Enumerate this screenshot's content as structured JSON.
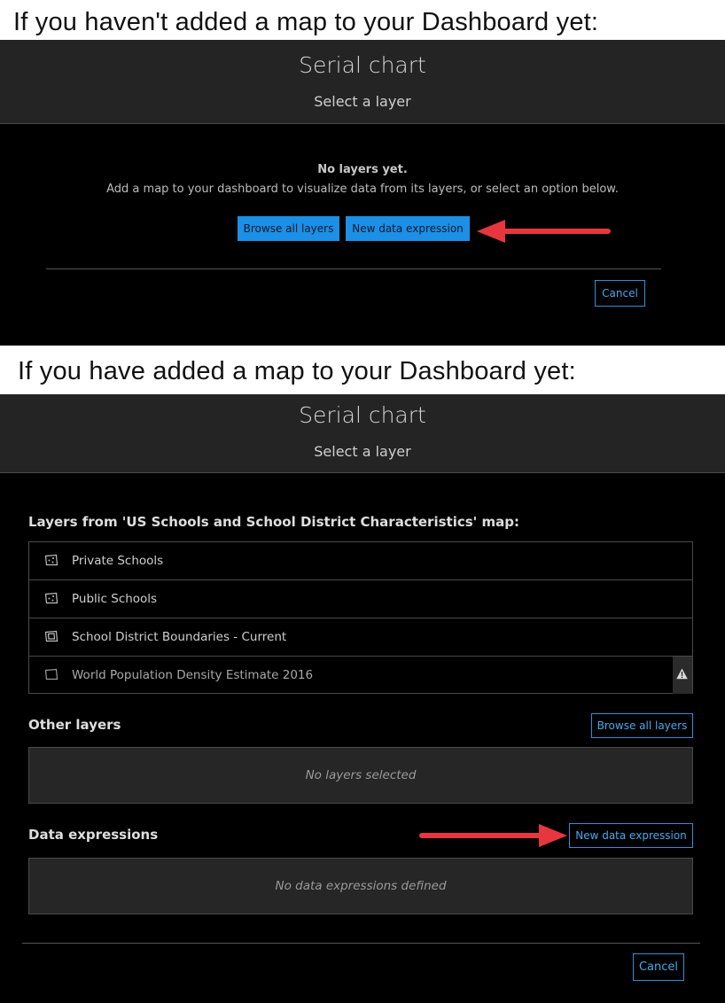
{
  "captions": {
    "top": "If you haven't added a map to your Dashboard yet:",
    "bottom": "If you have added a map to your Dashboard yet:"
  },
  "panel1": {
    "title": "Serial chart",
    "subtitle": "Select a layer",
    "empty_title": "No layers yet.",
    "empty_desc": "Add a map to your dashboard to visualize data from its layers, or select an option below.",
    "browse_label": "Browse all layers",
    "new_expr_label": "New data expression",
    "cancel_label": "Cancel"
  },
  "panel2": {
    "title": "Serial chart",
    "subtitle": "Select a layer",
    "map_layers_heading": "Layers from 'US Schools and School District Characteristics' map:",
    "layers": [
      {
        "label": "Private Schools",
        "icon": "point-layer-icon"
      },
      {
        "label": "Public Schools",
        "icon": "point-layer-icon"
      },
      {
        "label": "School District Boundaries - Current",
        "icon": "polygon-layer-icon"
      },
      {
        "label": "World Population Density Estimate 2016",
        "icon": "tile-layer-icon",
        "warning": true
      }
    ],
    "other_layers_heading": "Other layers",
    "browse_label": "Browse all layers",
    "no_layers_text": "No layers selected",
    "data_expressions_heading": "Data expressions",
    "new_expr_label": "New data expression",
    "no_expr_text": "No data expressions defined",
    "cancel_label": "Cancel"
  },
  "colors": {
    "accent": "#1c8fe6",
    "arrow": "#e8363f"
  }
}
